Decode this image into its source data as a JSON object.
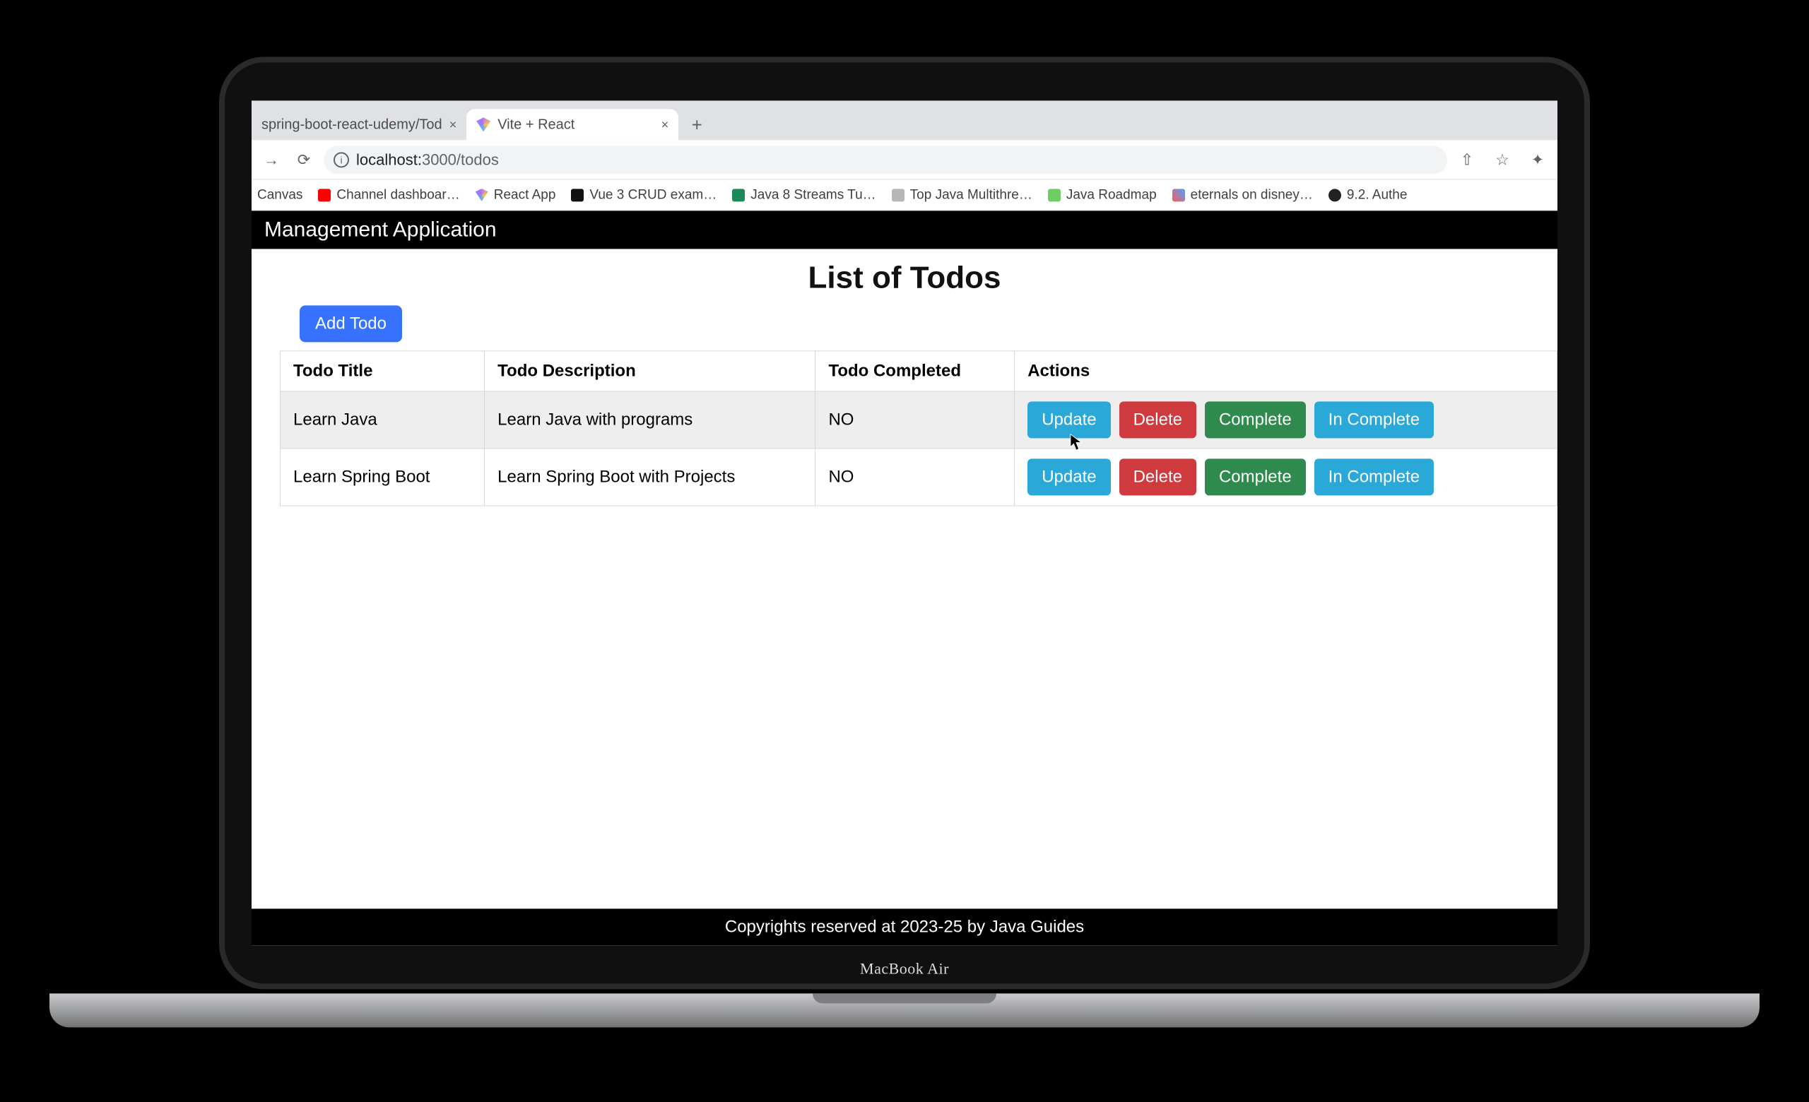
{
  "device": {
    "brand": "MacBook Air"
  },
  "browser": {
    "tabs": [
      {
        "title": "spring-boot-react-udemy/Tod",
        "active": false
      },
      {
        "title": "Vite + React",
        "active": true
      }
    ],
    "new_tab_glyph": "+",
    "nav": {
      "forward_glyph": "→",
      "reload_glyph": "⟳"
    },
    "omnibox": {
      "info_glyph": "i",
      "url_host": "localhost:",
      "url_port_path": "3000/todos"
    },
    "right_icons": {
      "share_glyph": "⇧",
      "star_glyph": "☆",
      "puzzle_glyph": "✦"
    },
    "bookmarks": [
      {
        "label": "Canvas",
        "color": "#d0d0d0"
      },
      {
        "label": "Channel dashboar…",
        "color": "#ff0000"
      },
      {
        "label": "React App",
        "color": ""
      },
      {
        "label": "Vue 3 CRUD exam…",
        "color": "#111"
      },
      {
        "label": "Java 8 Streams Tu…",
        "color": "#1a8a5a"
      },
      {
        "label": "Top Java Multithre…",
        "color": "#b6b6b6"
      },
      {
        "label": "Java Roadmap",
        "color": "#6fce63"
      },
      {
        "label": "eternals on disney…",
        "color": ""
      },
      {
        "label": "9.2. Authe",
        "color": "#222"
      }
    ]
  },
  "app": {
    "header_title": "Management Application",
    "page_title": "List of Todos",
    "add_button": "Add Todo",
    "columns": [
      "Todo Title",
      "Todo Description",
      "Todo Completed",
      "Actions"
    ],
    "action_labels": {
      "update": "Update",
      "delete": "Delete",
      "complete": "Complete",
      "incomplete": "In Complete"
    },
    "rows": [
      {
        "title": "Learn Java",
        "description": "Learn Java with programs",
        "completed": "NO"
      },
      {
        "title": "Learn Spring Boot",
        "description": "Learn Spring Boot with Projects",
        "completed": "NO"
      }
    ],
    "footer": "Copyrights reserved at 2023-25 by Java Guides"
  }
}
